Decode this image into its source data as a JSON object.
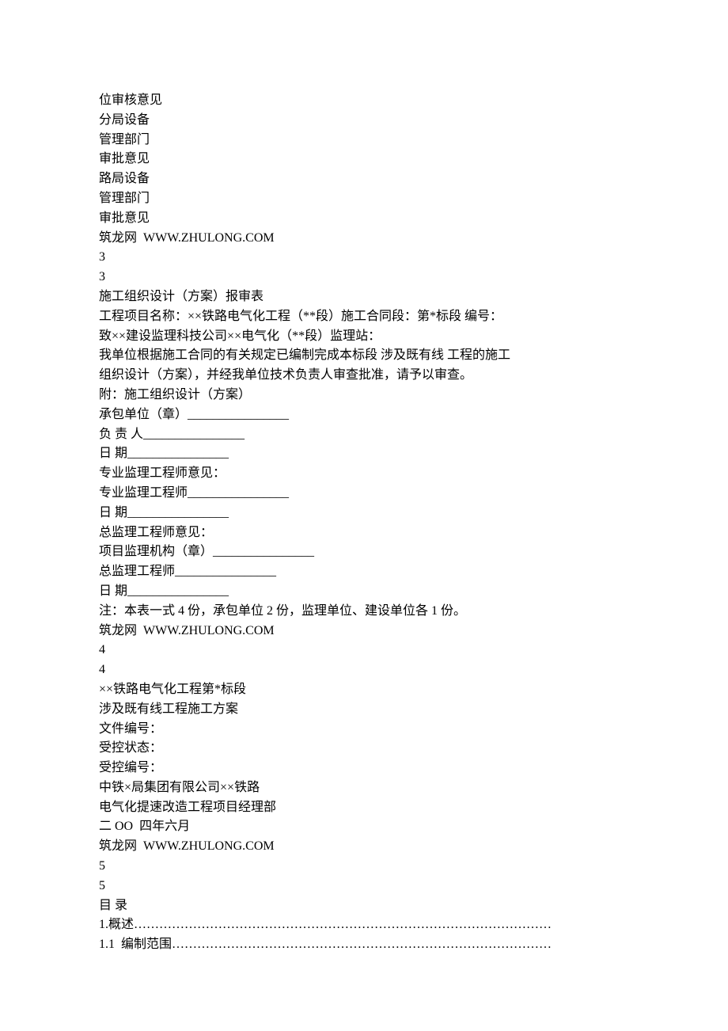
{
  "lines": [
    "位审核意见",
    "分局设备",
    "管理部门",
    "审批意见",
    "路局设备",
    "管理部门",
    "审批意见",
    "筑龙网  WWW.ZHULONG.COM",
    "3",
    "3",
    "施工组织设计（方案）报审表",
    "工程项目名称：××铁路电气化工程（**段）施工合同段：第*标段 编号：",
    "致××建设监理科技公司××电气化（**段）监理站：",
    "我单位根据施工合同的有关规定已编制完成本标段 涉及既有线 工程的施工",
    "组织设计（方案），并经我单位技术负责人审查批准，请予以审查。",
    "附：施工组织设计（方案）",
    "承包单位（章）________________",
    "负 责 人________________",
    "日 期________________",
    "专业监理工程师意见：",
    "专业监理工程师________________",
    "日 期________________",
    "总监理工程师意见：",
    "项目监理机构（章）________________",
    "总监理工程师________________",
    "日 期________________",
    "注：本表一式 4 份，承包单位 2 份，监理单位、建设单位各 1 份。",
    "筑龙网  WWW.ZHULONG.COM",
    "4",
    "4",
    "××铁路电气化工程第*标段",
    "涉及既有线工程施工方案",
    "文件编号：",
    "受控状态：",
    "受控编号：",
    "中铁×局集团有限公司××铁路",
    "电气化提速改造工程项目经理部",
    "二 OO  四年六月",
    "筑龙网  WWW.ZHULONG.COM",
    "5",
    "5",
    "目 录",
    "1.概述………………………………………………………………………………………",
    "1.1  编制范围………………………………………………………………………………"
  ]
}
